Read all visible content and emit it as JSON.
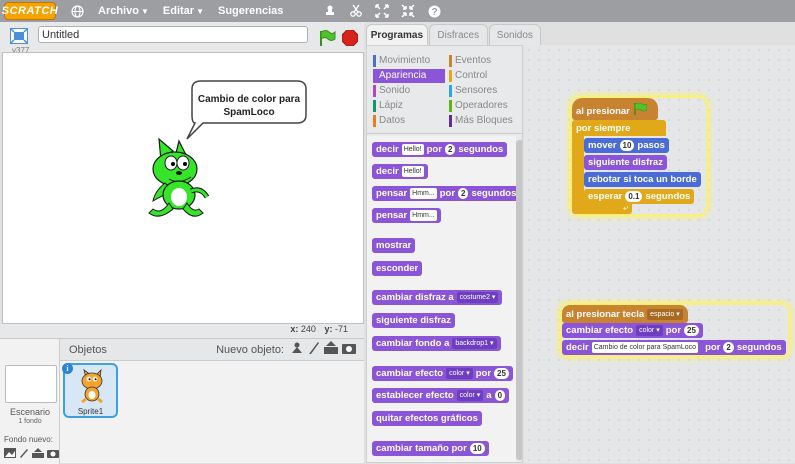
{
  "menubar": {
    "logo": "SCRATCH",
    "items": [
      "Archivo",
      "Editar",
      "Sugerencias"
    ],
    "icons": [
      "globe-icon",
      "duplicate-icon",
      "cut-icon",
      "grow-icon",
      "shrink-icon",
      "help-icon"
    ]
  },
  "stage": {
    "title": "Untitled",
    "version": "v377",
    "speech": "Cambio de color para SpamLoco",
    "x_label": "x:",
    "x_value": "240",
    "y_label": "y:",
    "y_value": "-71"
  },
  "sprites": {
    "header": "Objetos",
    "new_sprite": "Nuevo objeto:",
    "stage_label": "Escenario",
    "stage_sub": "1 fondo",
    "new_bg": "Fondo nuevo:",
    "sprite_name": "Sprite1"
  },
  "tabs": [
    "Programas",
    "Disfraces",
    "Sonidos"
  ],
  "categories": {
    "left": [
      "Movimiento",
      "Apariencia",
      "Sonido",
      "Lápiz",
      "Datos"
    ],
    "right": [
      "Eventos",
      "Control",
      "Sensores",
      "Operadores",
      "Más Bloques"
    ],
    "colors_left": [
      "#4a6cd4",
      "#8a55d7",
      "#bb42c3",
      "#0e9a6c",
      "#ee7d16"
    ],
    "colors_right": [
      "#c88330",
      "#e1a91a",
      "#2ca5e2",
      "#5cb712",
      "#632d99"
    ]
  },
  "palette": {
    "b1": {
      "a": "decir",
      "i": "Hello!",
      "b": "por",
      "n": "2",
      "c": "segundos"
    },
    "b2": {
      "a": "decir",
      "i": "Hello!"
    },
    "b3": {
      "a": "pensar",
      "i": "Hmm...",
      "b": "por",
      "n": "2",
      "c": "segundos"
    },
    "b4": {
      "a": "pensar",
      "i": "Hmm..."
    },
    "b5": "mostrar",
    "b6": "esconder",
    "b7": {
      "a": "cambiar disfraz a",
      "d": "costume2"
    },
    "b8": "siguiente disfraz",
    "b9": {
      "a": "cambiar fondo a",
      "d": "backdrop1"
    },
    "b10": {
      "a": "cambiar efecto",
      "d": "color",
      "b": "por",
      "n": "25"
    },
    "b11": {
      "a": "establecer efecto",
      "d": "color",
      "b": "a",
      "n": "0"
    },
    "b12": "quitar efectos gráficos",
    "b13": {
      "a": "cambiar tamaño por",
      "n": "10"
    }
  },
  "script1": {
    "hat": "al presionar",
    "forever": "por siempre",
    "move_a": "mover",
    "move_n": "10",
    "move_b": "pasos",
    "next": "siguiente disfraz",
    "bounce": "rebotar si toca un borde",
    "wait_a": "esperar",
    "wait_n": "0.1",
    "wait_b": "segundos"
  },
  "script2": {
    "hat": "al presionar tecla",
    "key": "espacio",
    "change_a": "cambiar efecto",
    "change_d": "color",
    "change_b": "por",
    "change_n": "25",
    "say_a": "decir",
    "say_i": "Cambio de color para SpamLoco",
    "say_b": "por",
    "say_n": "2",
    "say_c": "segundos"
  }
}
